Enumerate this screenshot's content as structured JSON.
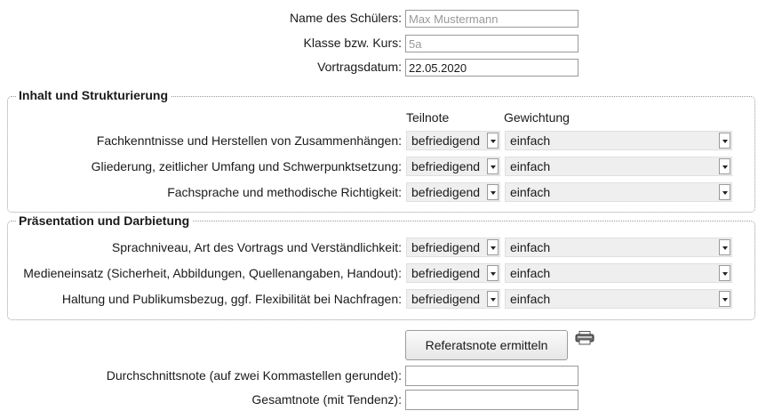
{
  "student": {
    "name_label": "Name des Schülers:",
    "name_placeholder": "Max Mustermann",
    "class_label": "Klasse bzw. Kurs:",
    "class_placeholder": "5a",
    "date_label": "Vortragsdatum:",
    "date_value": "22.05.2020"
  },
  "columns": {
    "grade": "Teilnote",
    "weight": "Gewichtung"
  },
  "groups": [
    {
      "legend": "Inhalt und Strukturierung",
      "rows": [
        {
          "label": "Fachkenntnisse und Herstellen von Zusammenhängen:",
          "grade": "befriedigend",
          "weight": "einfach"
        },
        {
          "label": "Gliederung, zeitlicher Umfang und Schwerpunktsetzung:",
          "grade": "befriedigend",
          "weight": "einfach"
        },
        {
          "label": "Fachsprache und methodische Richtigkeit:",
          "grade": "befriedigend",
          "weight": "einfach"
        }
      ]
    },
    {
      "legend": "Präsentation und Darbietung",
      "rows": [
        {
          "label": "Sprachniveau, Art des Vortrags und Verständlichkeit:",
          "grade": "befriedigend",
          "weight": "einfach"
        },
        {
          "label": "Medieneinsatz (Sicherheit, Abbildungen, Quellenangaben, Handout):",
          "grade": "befriedigend",
          "weight": "einfach"
        },
        {
          "label": "Haltung und Publikumsbezug, ggf. Flexibilität bei Nachfragen:",
          "grade": "befriedigend",
          "weight": "einfach"
        }
      ]
    }
  ],
  "actions": {
    "compute_label": "Referatsnote ermitteln",
    "print_icon": "printer-icon"
  },
  "results": {
    "average_label": "Durchschnittsnote (auf zwei Kommastellen gerundet):",
    "average_value": "",
    "total_label": "Gesamtnote (mit Tendenz):",
    "total_value": ""
  }
}
